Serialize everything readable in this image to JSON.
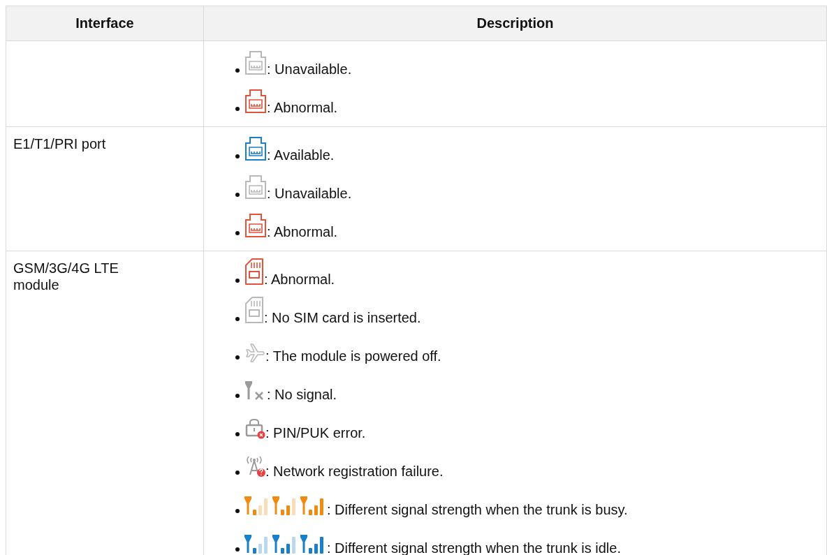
{
  "table": {
    "columns": [
      "Interface",
      "Description"
    ],
    "rows": [
      {
        "items": [
          {
            "kind": "port",
            "color": "#b8b8b8",
            "text": ": Unavailable."
          },
          {
            "kind": "port",
            "color": "#e2533a",
            "text": ": Abnormal."
          }
        ]
      },
      {
        "interface": "E1/T1/PRI port",
        "items": [
          {
            "kind": "port",
            "color": "#1a7fc9",
            "text": ": Available."
          },
          {
            "kind": "port",
            "color": "#b8b8b8",
            "text": ": Unavailable."
          },
          {
            "kind": "port",
            "color": "#e2533a",
            "text": ": Abnormal."
          }
        ]
      },
      {
        "interface": "GSM/3G/4G LTE module",
        "items": [
          {
            "kind": "sim",
            "color": "#e2533a",
            "text": ": Abnormal."
          },
          {
            "kind": "sim",
            "color": "#b8b8b8",
            "text": ": No SIM card is inserted."
          },
          {
            "kind": "airplane",
            "text": ": The module is powered off."
          },
          {
            "kind": "nosignal",
            "text": ": No signal."
          },
          {
            "kind": "lock",
            "text": ": PIN/PUK error."
          },
          {
            "kind": "tower",
            "text": ": Network registration failure."
          },
          {
            "kind": "signal",
            "color": "#f08a10",
            "text": ": Different signal strength when the trunk is busy."
          },
          {
            "kind": "signal",
            "color": "#1a7fc9",
            "text": ": Different signal strength when the trunk is idle."
          }
        ]
      }
    ]
  }
}
